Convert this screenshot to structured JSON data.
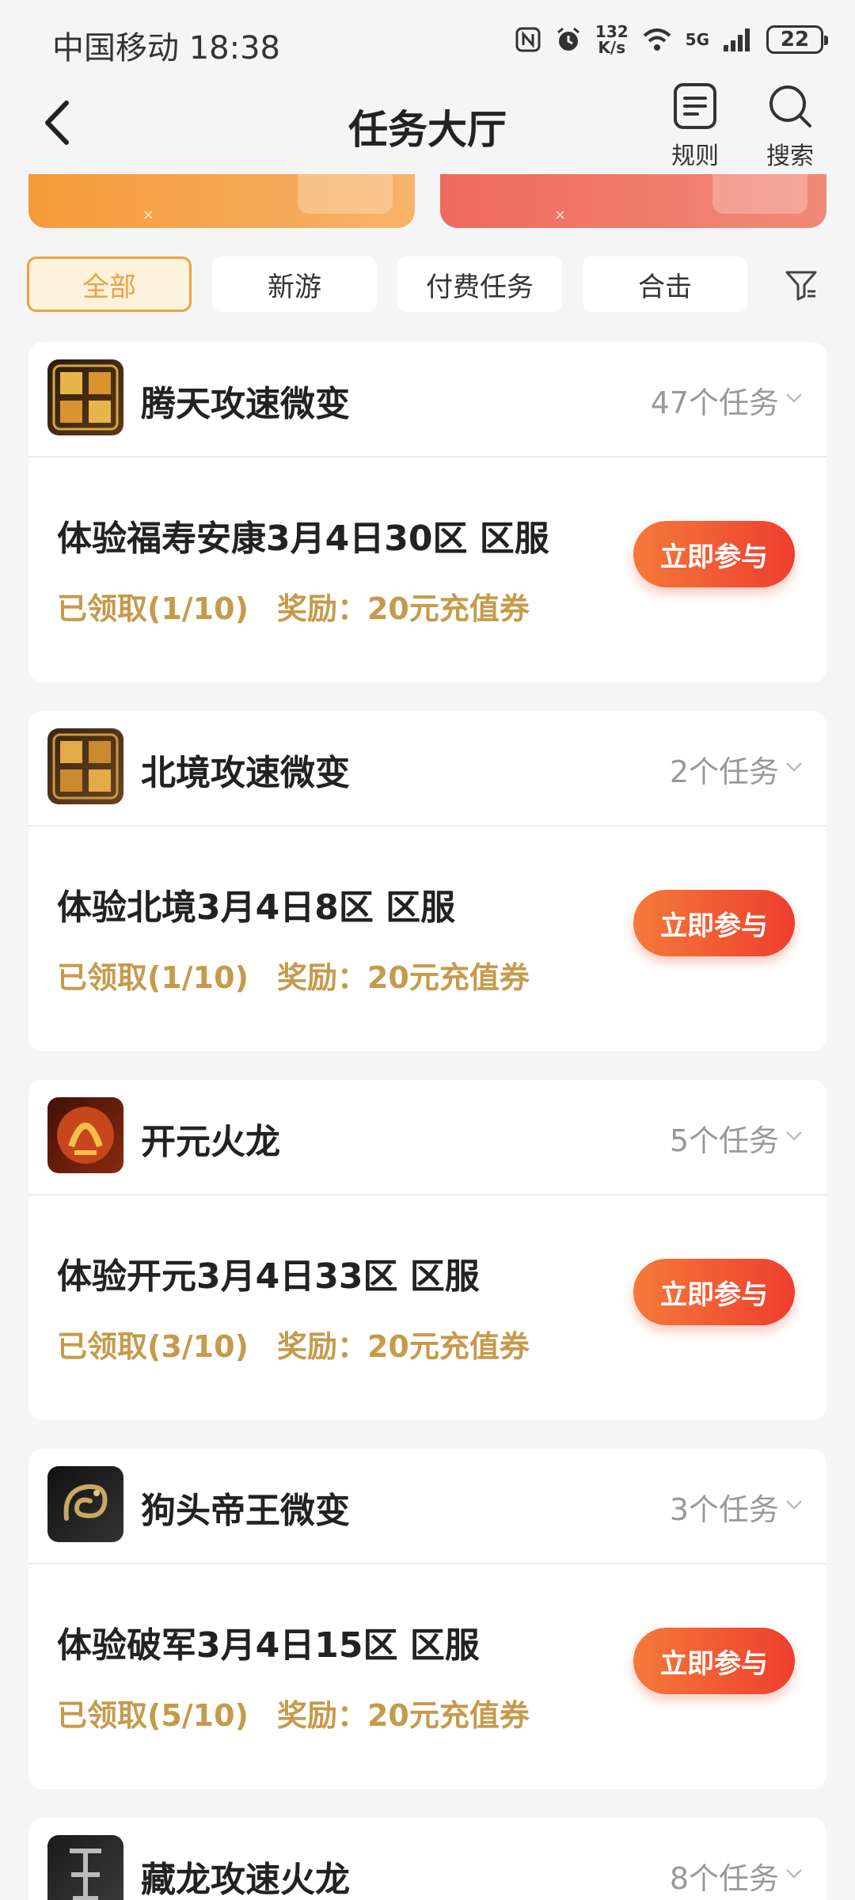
{
  "status_bar": {
    "carrier_time": "中国移动 18:38",
    "speed_value": "132",
    "speed_unit": "K/s",
    "network": "5G",
    "battery": "22"
  },
  "header": {
    "title": "任务大厅",
    "rules_label": "规则",
    "search_label": "搜索"
  },
  "tabs": [
    {
      "label": "全部",
      "active": true
    },
    {
      "label": "新游",
      "active": false
    },
    {
      "label": "付费任务",
      "active": false
    },
    {
      "label": "合击",
      "active": false
    }
  ],
  "cards": [
    {
      "game": "腾天攻速微变",
      "count": "47个任务",
      "task": "体验福寿安康3月4日30区 区服",
      "claimed": "已领取(1/10)",
      "reward": "奖励：20元充值券",
      "button": "立即参与"
    },
    {
      "game": "北境攻速微变",
      "count": "2个任务",
      "task": "体验北境3月4日8区 区服",
      "claimed": "已领取(1/10)",
      "reward": "奖励：20元充值券",
      "button": "立即参与"
    },
    {
      "game": "开元火龙",
      "count": "5个任务",
      "task": "体验开元3月4日33区 区服",
      "claimed": "已领取(3/10)",
      "reward": "奖励：20元充值券",
      "button": "立即参与"
    },
    {
      "game": "狗头帝王微变",
      "count": "3个任务",
      "task": "体验破军3月4日15区 区服",
      "claimed": "已领取(5/10)",
      "reward": "奖励：20元充值券",
      "button": "立即参与"
    },
    {
      "game": "藏龙攻速火龙",
      "count": "8个任务"
    }
  ],
  "colors": {
    "accent": "#f0a040",
    "button_start": "#f47a3a",
    "button_end": "#ee3e2e",
    "meta_text": "#c69a4c"
  }
}
